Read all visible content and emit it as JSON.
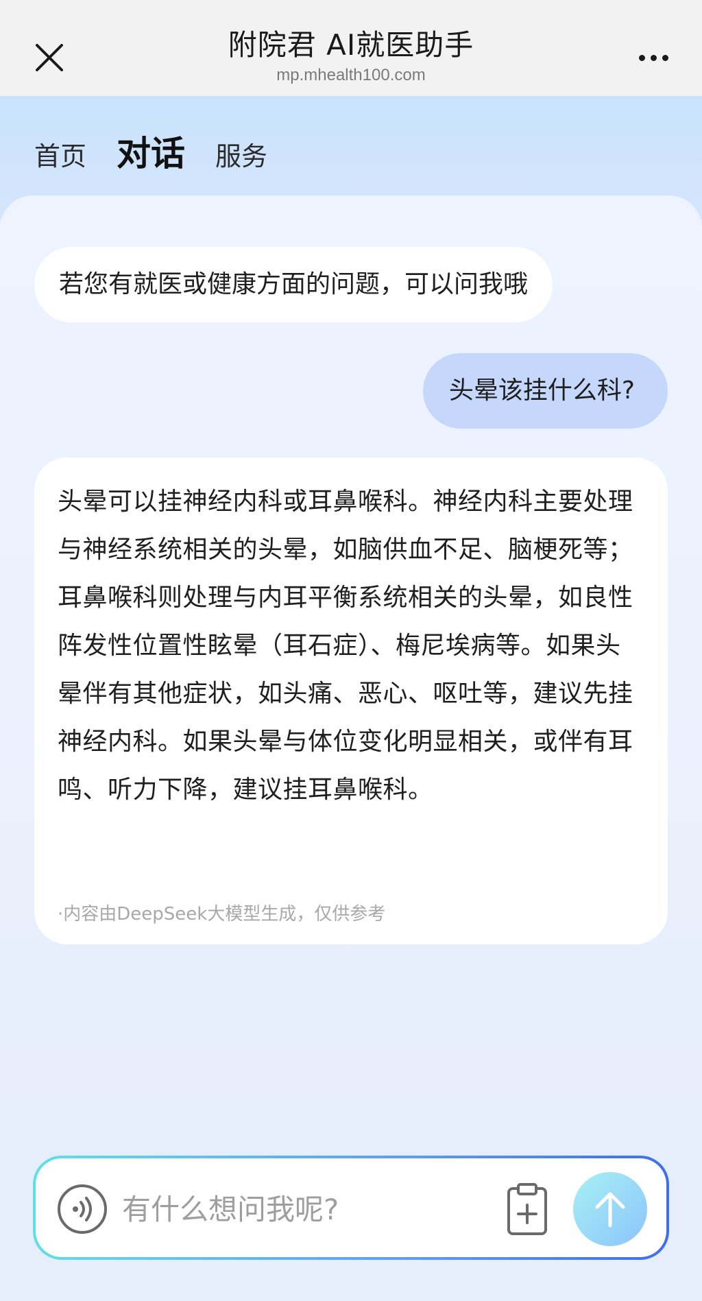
{
  "titlebar": {
    "title": "附院君 AI就医助手",
    "url": "mp.mhealth100.com",
    "close_icon": "close-icon",
    "more_icon": "more-dots-icon"
  },
  "tabs": [
    {
      "label": "首页",
      "active": false
    },
    {
      "label": "对话",
      "active": true
    },
    {
      "label": "服务",
      "active": false
    }
  ],
  "chat": {
    "greeting": "若您有就医或健康方面的问题，可以问我哦",
    "user_message": "头晕该挂什么科?",
    "answer": "头晕可以挂神经内科或耳鼻喉科。神经内科主要处理与神经系统相关的头晕，如脑供血不足、脑梗死等；耳鼻喉科则处理与内耳平衡系统相关的头晕，如良性阵发性位置性眩晕（耳石症）、梅尼埃病等。如果头晕伴有其他症状，如头痛、恶心、呕吐等，建议先挂神经内科。如果头晕与体位变化明显相关，或伴有耳鸣、听力下降，建议挂耳鼻喉科。",
    "ai_note": "·内容由DeepSeek大模型生成，仅供参考"
  },
  "input": {
    "placeholder": "有什么想问我呢?",
    "value": "",
    "voice_icon": "voice-icon",
    "clipboard_icon": "clipboard-add-icon",
    "send_icon": "arrow-up-icon"
  },
  "colors": {
    "header_bg": "#c9e2fd",
    "user_bubble": "#c5d8fb",
    "bot_bubble": "#ffffff",
    "send_gradient_start": "#a8f0f4",
    "send_gradient_end": "#8cc4fb"
  }
}
